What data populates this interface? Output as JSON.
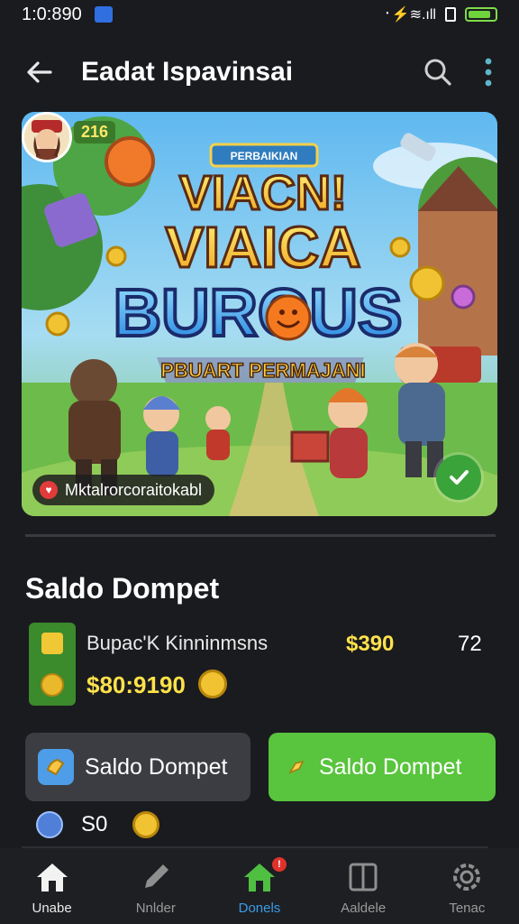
{
  "status_bar": {
    "time": "1:0:890",
    "signal": "᛫⚡≋.ıll"
  },
  "header": {
    "title": "Eadat Ispavinsai"
  },
  "banner": {
    "top_plate": "PERBAIKIAN",
    "title_line1": "VIACN!",
    "title_line2": "VIAICA",
    "title_line3": "BUROUS",
    "ribbon": "PBUART PERMAJANI",
    "level": "216",
    "chip_label": "Mktalrorcoraitokabl"
  },
  "wallet": {
    "section_title": "Saldo Dompet",
    "name": "Bupac'K Kinninmsns",
    "amount": "$390",
    "count": "72",
    "sub_amount": "$80:9190"
  },
  "buttons": {
    "left_label": "Saldo Dompet",
    "right_label": "Saldo Dompet"
  },
  "balance": {
    "value": "S0"
  },
  "nav": {
    "items": [
      {
        "label": "Unabe"
      },
      {
        "label": "Nnlder"
      },
      {
        "label": "Donels"
      },
      {
        "label": "Aaldele"
      },
      {
        "label": "Tenac"
      }
    ],
    "badge": "!"
  },
  "colors": {
    "accent_green": "#59c43d",
    "accent_blue": "#3a9ce6",
    "coin_gold": "#f1c232",
    "background": "#1a1b1f"
  }
}
